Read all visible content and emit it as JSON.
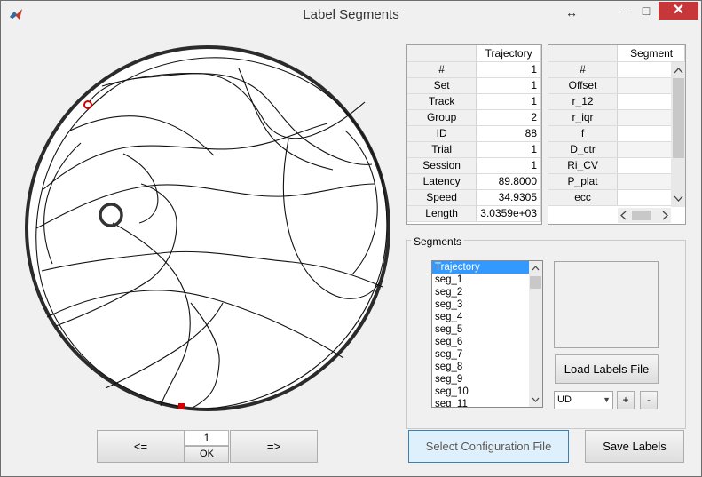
{
  "window": {
    "title": "Label Segments",
    "resize_symbol": "↔",
    "min_symbol": "–",
    "max_symbol": "□",
    "close_symbol": "✕"
  },
  "trajectory_table": {
    "header": "Trajectory",
    "rows": [
      {
        "label": "#",
        "value": "1"
      },
      {
        "label": "Set",
        "value": "1"
      },
      {
        "label": "Track",
        "value": "1"
      },
      {
        "label": "Group",
        "value": "2"
      },
      {
        "label": "ID",
        "value": "88"
      },
      {
        "label": "Trial",
        "value": "1"
      },
      {
        "label": "Session",
        "value": "1"
      },
      {
        "label": "Latency",
        "value": "89.8000"
      },
      {
        "label": "Speed",
        "value": "34.9305"
      },
      {
        "label": "Length",
        "value": "3.0359e+03"
      }
    ]
  },
  "segment_table": {
    "header": "Segment",
    "rows": [
      "#",
      "Offset",
      "r_12",
      "r_iqr",
      "f",
      "D_ctr",
      "Ri_CV",
      "P_plat",
      "ecc"
    ]
  },
  "segments_group": {
    "label": "Segments",
    "items": [
      "Trajectory",
      "seg_1",
      "seg_2",
      "seg_3",
      "seg_4",
      "seg_5",
      "seg_6",
      "seg_7",
      "seg_8",
      "seg_9",
      "seg_10",
      "seg_11"
    ],
    "selected": "Trajectory"
  },
  "buttons": {
    "load_labels": "Load Labels File",
    "plus": "+",
    "minus": "-",
    "select_config": "Select Configuration File",
    "save_labels": "Save Labels",
    "prev": "<=",
    "next": "=>",
    "ok": "OK"
  },
  "label_dropdown": {
    "value": "UD"
  },
  "navigation": {
    "current_index": "1"
  },
  "colors": {
    "selection": "#3399ff",
    "close_button": "#c7373a",
    "marker": "#d00000"
  }
}
